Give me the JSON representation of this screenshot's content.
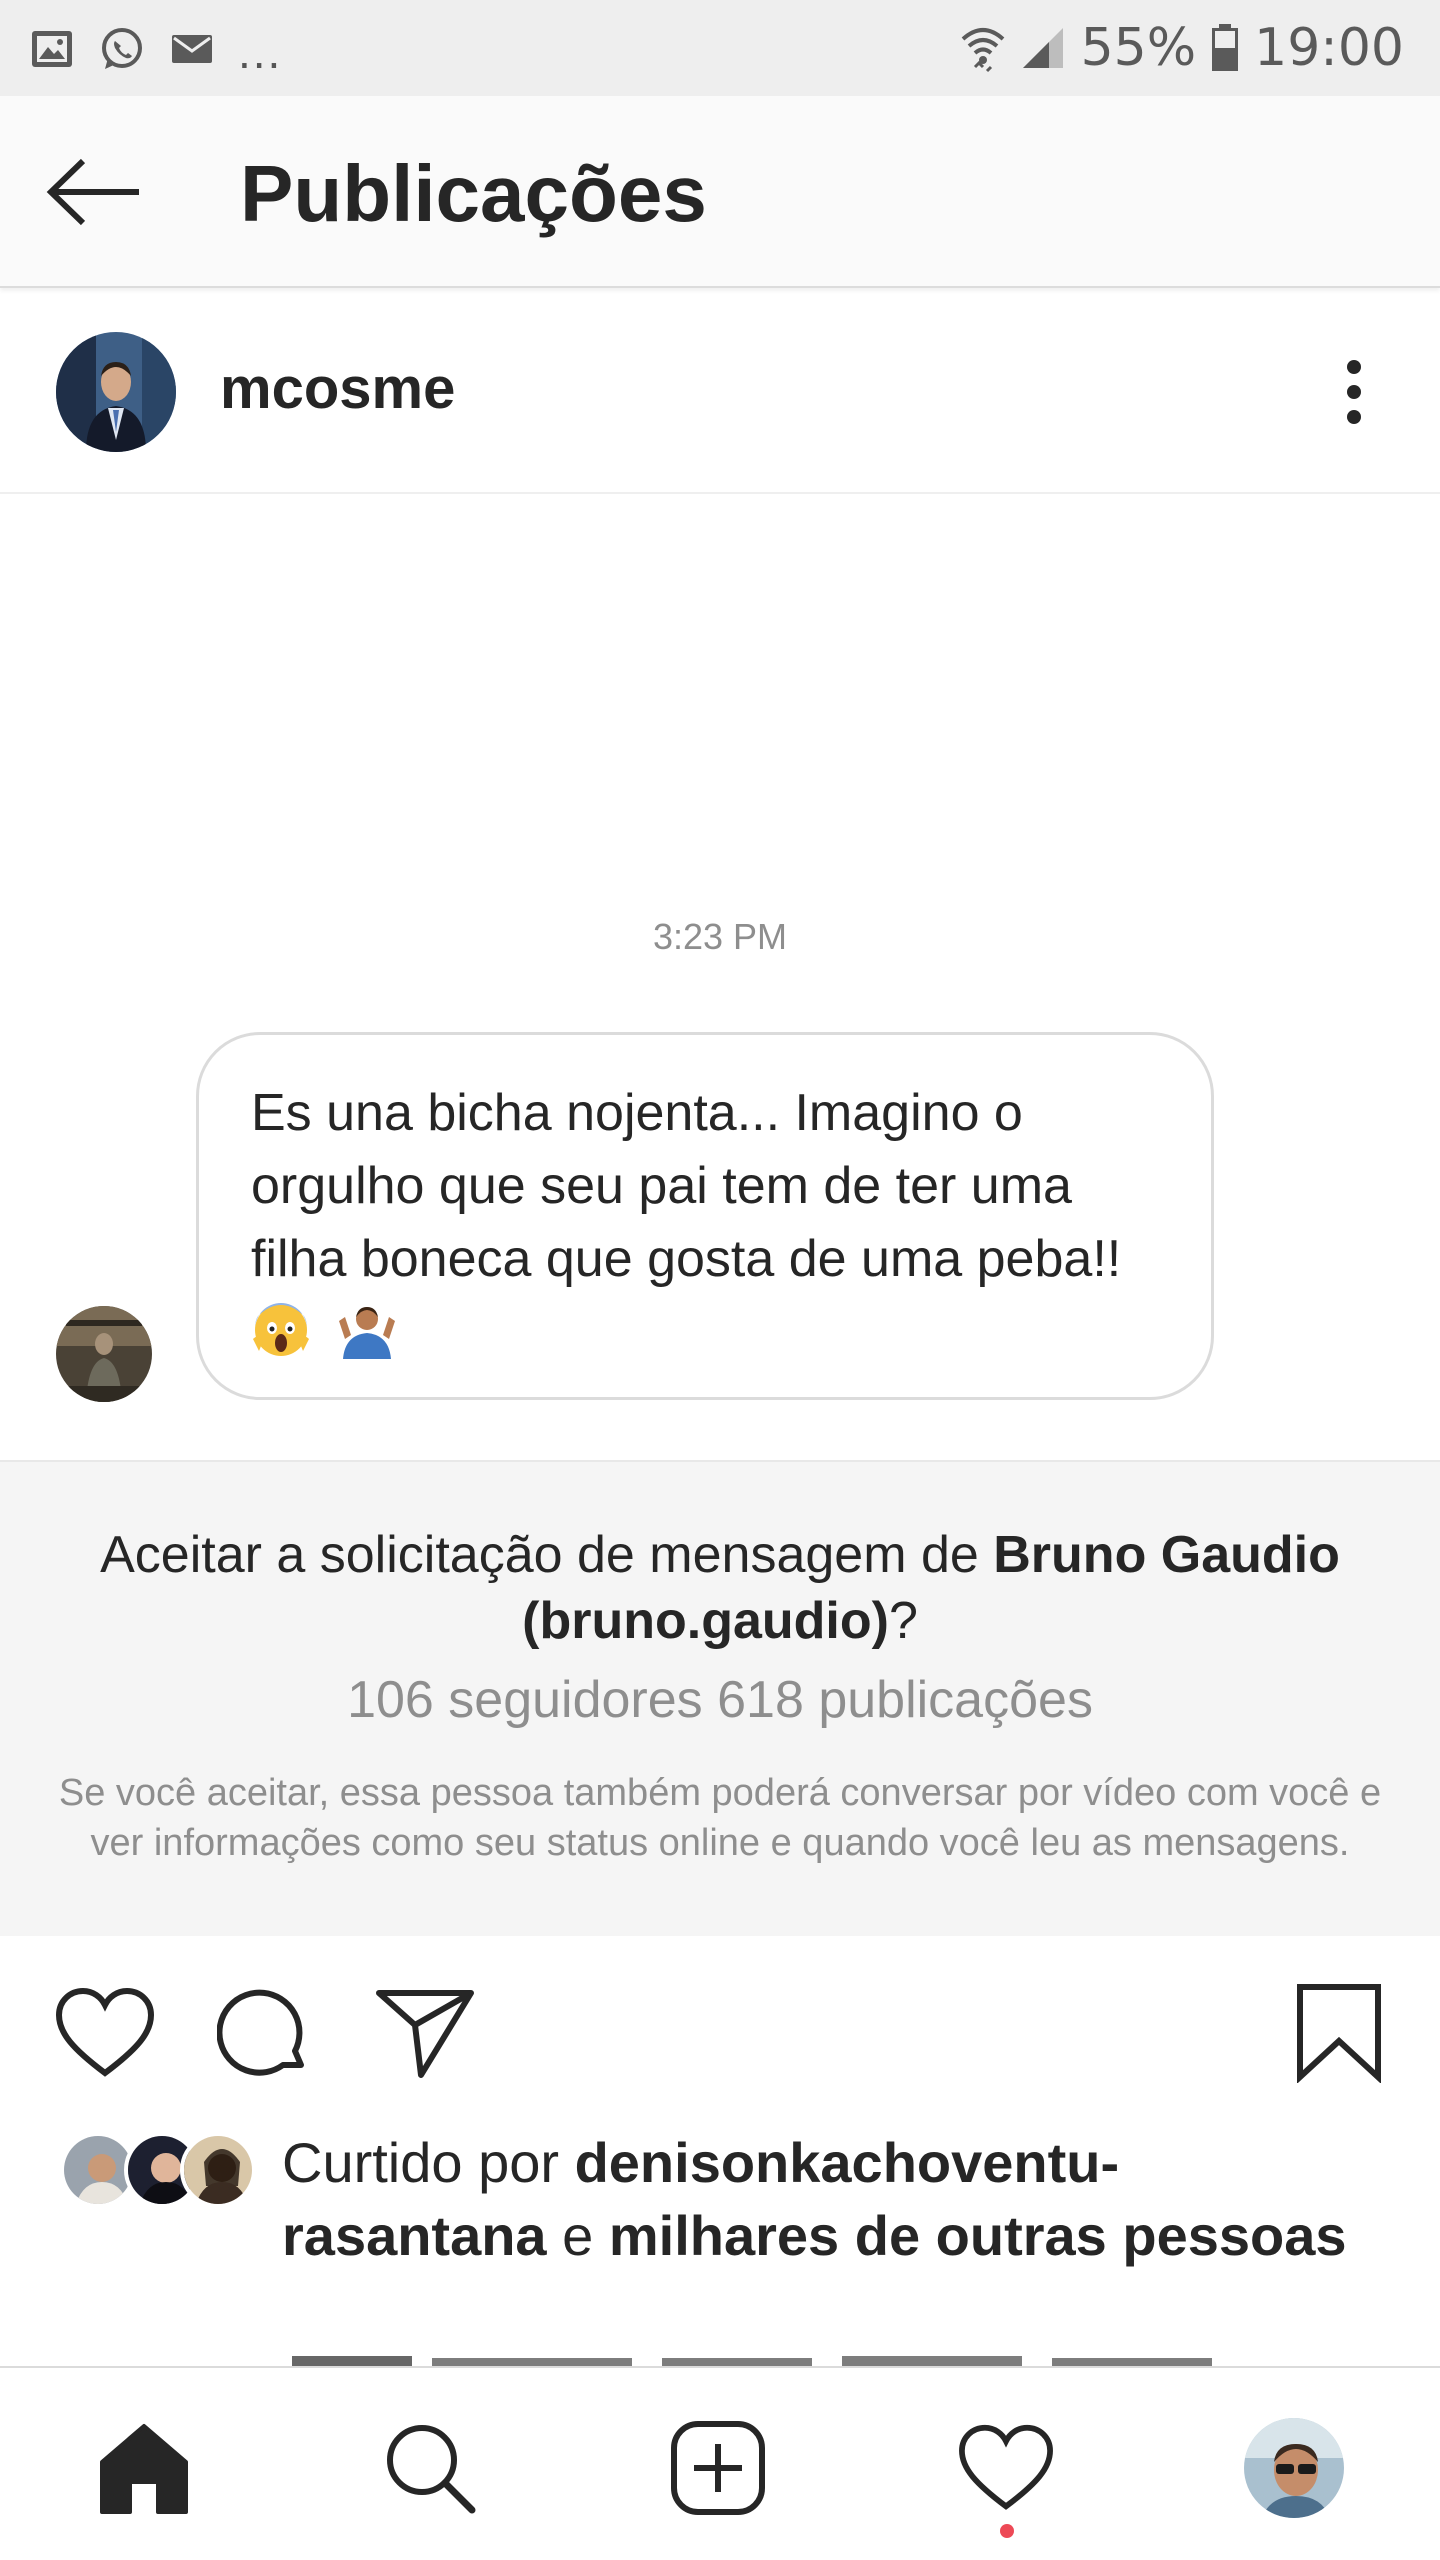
{
  "status_bar": {
    "icons": [
      "image-icon",
      "whatsapp-icon",
      "mail-icon"
    ],
    "more": "...",
    "battery": "55%",
    "time": "19:00"
  },
  "header": {
    "title": "Publicações"
  },
  "post": {
    "author": "mcosme"
  },
  "chat": {
    "time": "3:23 PM",
    "message": "Es una bicha nojenta... Imagino o orgulho que seu pai tem de ter uma filha boneca que gosta de uma peba!!",
    "emojis": [
      "scream-emoji",
      "shrug-emoji"
    ]
  },
  "request": {
    "question_prefix": "Aceitar a solicitação de mensagem de ",
    "name": "Bruno Gaudio (bruno.gaudio)",
    "question_suffix": "?",
    "stats": "106 seguidores 618 publicações",
    "note": "Se você aceitar, essa pessoa também poderá conversar por vídeo com você e ver informações como seu status online e quando você leu as mensagens."
  },
  "likes": {
    "prefix": "Curtido por ",
    "user": "denisonkachoventu-rasantana",
    "connector": " e ",
    "others": "milhares de outras pessoas"
  },
  "colors": {
    "text": "#262626",
    "muted": "#8e8e8e",
    "notification": "#ed4956",
    "panel": "#f5f5f5"
  }
}
